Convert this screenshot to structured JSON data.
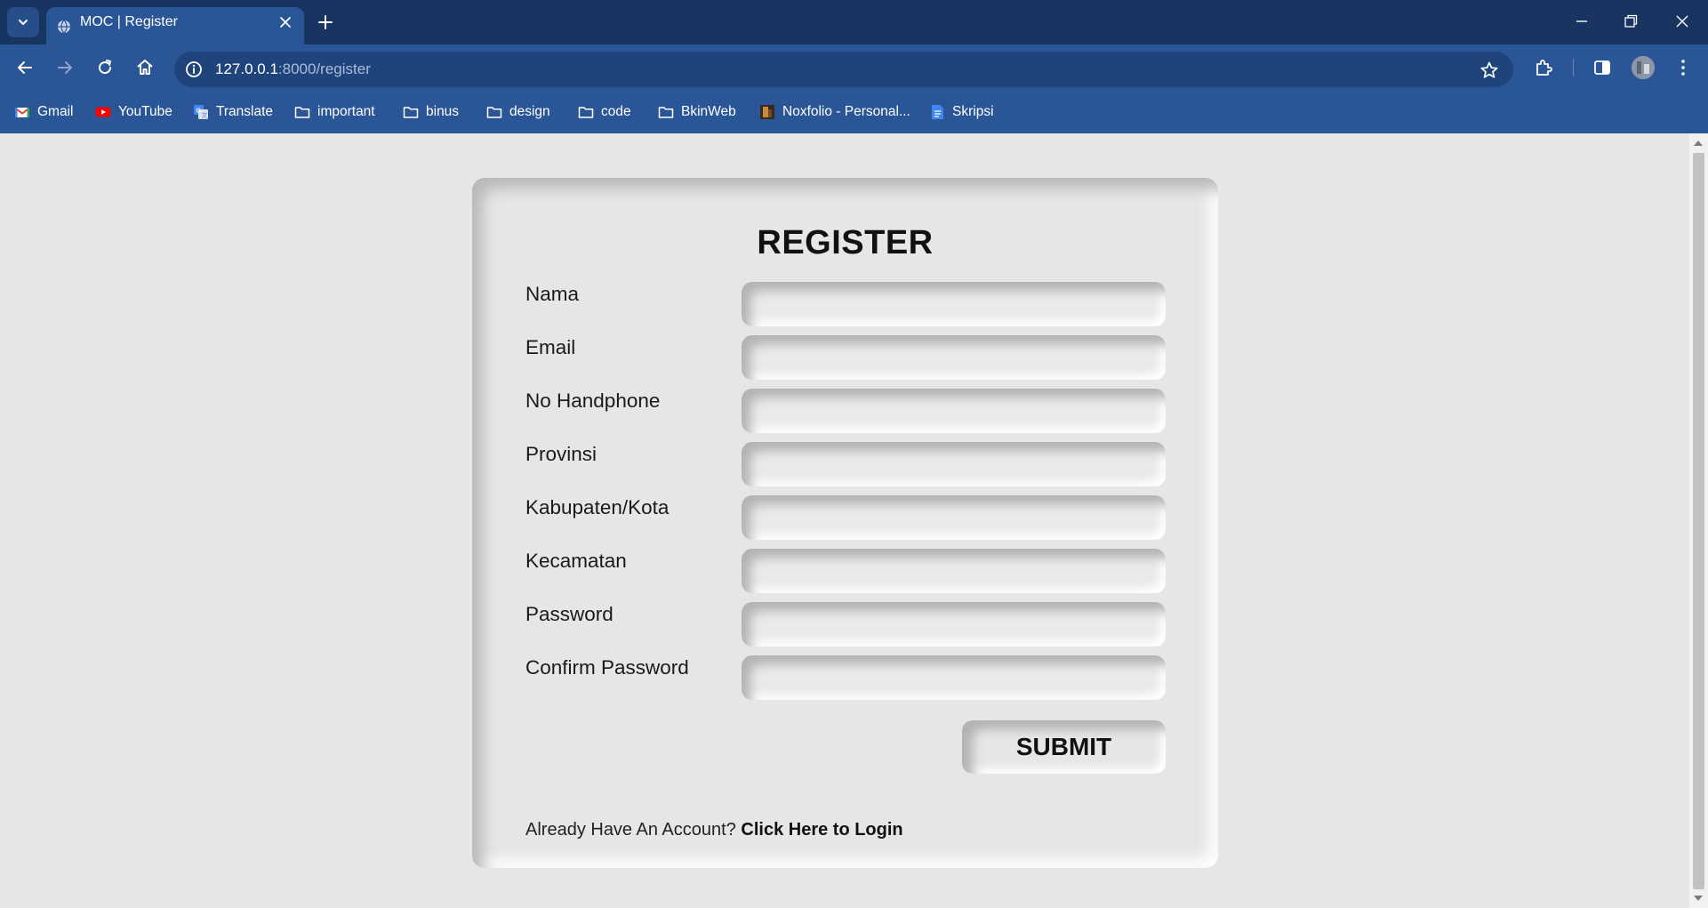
{
  "browser": {
    "tab_title": "MOC | Register",
    "url_host": "127.0.0.1",
    "url_path": ":8000/register",
    "bookmarks": [
      {
        "label": "Gmail",
        "icon": "gmail-icon"
      },
      {
        "label": "YouTube",
        "icon": "youtube-icon"
      },
      {
        "label": "Translate",
        "icon": "translate-icon"
      },
      {
        "label": "important",
        "icon": "folder-icon"
      },
      {
        "label": "binus",
        "icon": "folder-icon"
      },
      {
        "label": "design",
        "icon": "folder-icon"
      },
      {
        "label": "code",
        "icon": "folder-icon"
      },
      {
        "label": "BkinWeb",
        "icon": "folder-icon"
      },
      {
        "label": "Noxfolio - Personal...",
        "icon": "site-favicon"
      },
      {
        "label": "Skripsi",
        "icon": "docs-icon"
      }
    ]
  },
  "form": {
    "title": "REGISTER",
    "fields": [
      {
        "label": "Nama",
        "value": ""
      },
      {
        "label": "Email",
        "value": ""
      },
      {
        "label": "No Handphone",
        "value": ""
      },
      {
        "label": "Provinsi",
        "value": ""
      },
      {
        "label": "Kabupaten/Kota",
        "value": ""
      },
      {
        "label": "Kecamatan",
        "value": ""
      },
      {
        "label": "Password",
        "value": ""
      },
      {
        "label": "Confirm Password",
        "value": ""
      }
    ],
    "submit_label": "SUBMIT",
    "footer_text": "Already Have An Account?",
    "login_link": "Click Here to Login"
  }
}
